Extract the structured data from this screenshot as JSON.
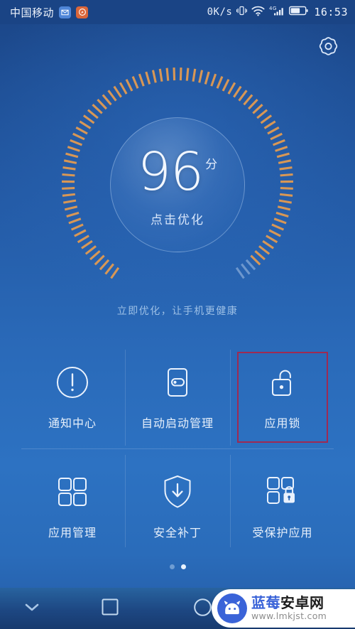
{
  "statusbar": {
    "carrier": "中国移动",
    "app_icons": [
      {
        "name": "messenger-icon",
        "glyph": "✉"
      },
      {
        "name": "compass-icon",
        "glyph": "✹"
      }
    ],
    "net_speed": "0K/s",
    "vibrate_icon": "vibrate-icon",
    "wifi_icon": "wifi-icon",
    "network_type": "4G",
    "signal_icon": "signal-bars-icon",
    "battery_icon": "battery-icon",
    "battery_level_pct": 60,
    "clock": "16:53"
  },
  "header": {
    "settings_icon": "gear-icon"
  },
  "gauge": {
    "score": "96",
    "unit": "分",
    "action_label": "点击优化",
    "percent": 96,
    "total_ticks": 84,
    "tick_color_active": "#e09a52",
    "tick_color_inactive": "#cfe0f5"
  },
  "tagline": "立即优化，让手机更健康",
  "tiles": [
    {
      "id": "notification-center",
      "label": "通知中心",
      "icon": "exclamation-circle-icon",
      "highlighted": false
    },
    {
      "id": "autostart-manager",
      "label": "自动启动管理",
      "icon": "toggle-card-icon",
      "highlighted": false
    },
    {
      "id": "app-lock",
      "label": "应用锁",
      "icon": "unlocked-padlock-icon",
      "highlighted": true
    },
    {
      "id": "app-manager",
      "label": "应用管理",
      "icon": "grid-four-squares-icon",
      "highlighted": false
    },
    {
      "id": "security-patch",
      "label": "安全补丁",
      "icon": "shield-download-icon",
      "highlighted": false
    },
    {
      "id": "protected-apps",
      "label": "受保护应用",
      "icon": "grid-lock-icon",
      "highlighted": false
    }
  ],
  "highlight_color": "#9e2a52",
  "pager": {
    "total": 2,
    "active_index": 1
  },
  "navbar": {
    "back_icon": "chevron-down-icon",
    "recents_icon": "square-icon",
    "home_icon": "circle-icon"
  },
  "watermark": {
    "logo_icon": "android-head-icon",
    "title_blue": "蓝莓",
    "title_dark": "安卓网",
    "url": "www.lmkjst.com"
  }
}
